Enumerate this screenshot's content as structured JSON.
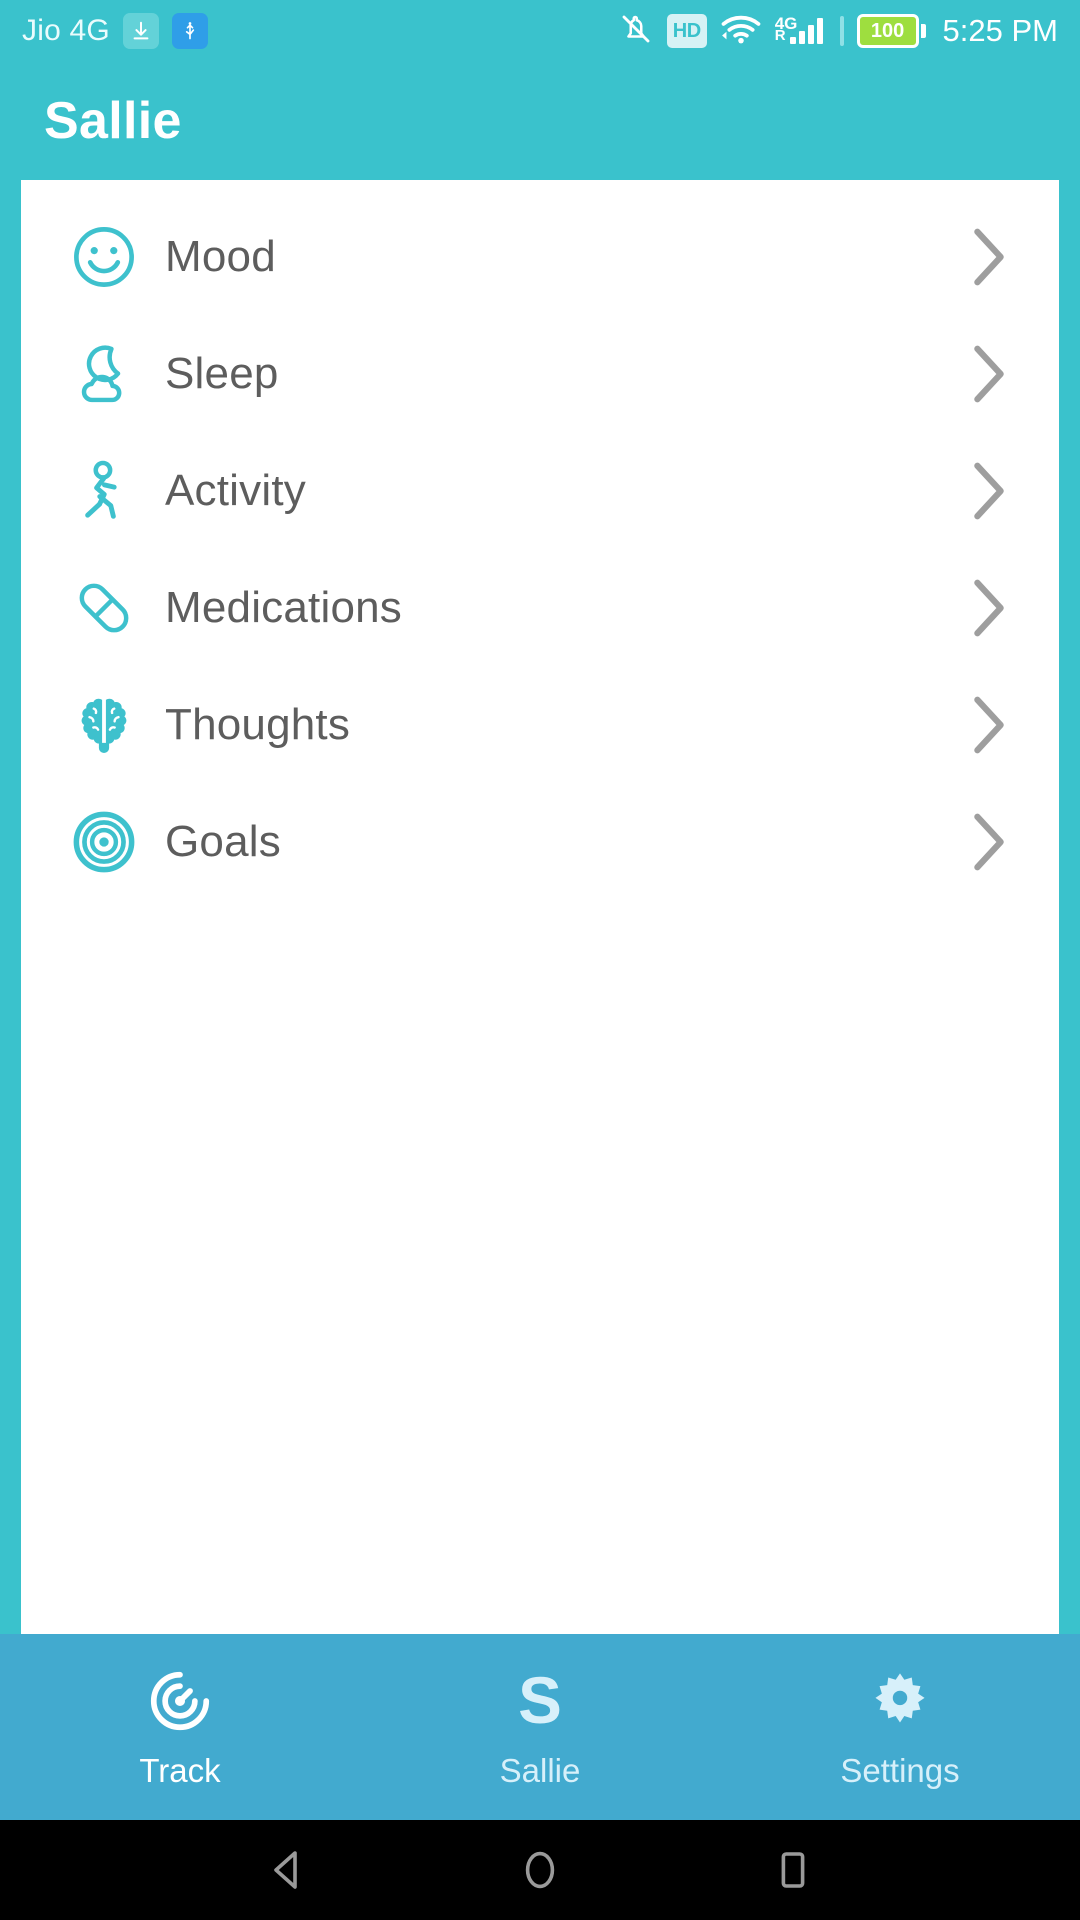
{
  "status_bar": {
    "carrier": "Jio 4G",
    "download_icon": "download-icon",
    "usb_icon": "usb-icon",
    "silent_icon": "bell-muted-icon",
    "hd_label": "HD",
    "wifi_icon": "wifi-icon",
    "network_type": "4G",
    "roaming_label": "R",
    "signal_icon": "signal-bars-icon",
    "battery_level": "100",
    "time": "5:25 PM"
  },
  "header": {
    "title": "Sallie"
  },
  "list": {
    "items": [
      {
        "label": "Mood",
        "icon": "smiley-face-icon",
        "chevron": "chevron-right-icon"
      },
      {
        "label": "Sleep",
        "icon": "moon-cloud-icon",
        "chevron": "chevron-right-icon"
      },
      {
        "label": "Activity",
        "icon": "running-person-icon",
        "chevron": "chevron-right-icon"
      },
      {
        "label": "Medications",
        "icon": "pill-capsule-icon",
        "chevron": "chevron-right-icon"
      },
      {
        "label": "Thoughts",
        "icon": "brain-icon",
        "chevron": "chevron-right-icon"
      },
      {
        "label": "Goals",
        "icon": "target-icon",
        "chevron": "chevron-right-icon"
      }
    ]
  },
  "tabbar": {
    "tabs": [
      {
        "label": "Track",
        "icon": "radar-spiral-icon",
        "active": true
      },
      {
        "label": "Sallie",
        "icon": "letter-s-icon",
        "active": false
      },
      {
        "label": "Settings",
        "icon": "gear-icon",
        "active": false
      }
    ]
  },
  "android_nav": {
    "back": "back-triangle-icon",
    "home": "home-circle-icon",
    "recents": "recents-square-icon"
  },
  "colors": {
    "header_teal": "#3AC2CC",
    "tabbar_blue": "#42AACF",
    "icon_teal": "#3EC1CD",
    "label_gray": "#5d5d5d",
    "chevron_gray": "#9e9e9e",
    "card_white": "#ffffff",
    "battery_green": "#9ede3f"
  }
}
